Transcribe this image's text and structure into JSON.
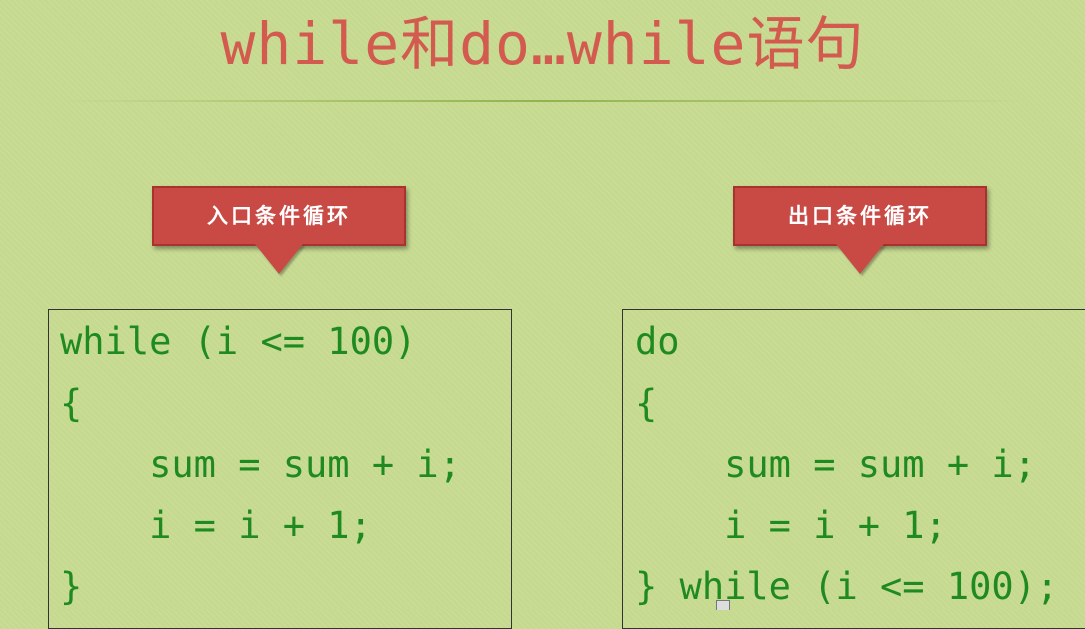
{
  "slide": {
    "title": "while和do…while语句"
  },
  "callouts": {
    "left_label": "入口条件循环",
    "right_label": "出口条件循环"
  },
  "code": {
    "while_loop": [
      "while (i <= 100)",
      "{",
      "    sum = sum + i;",
      "    i = i + 1;",
      "}"
    ],
    "do_while_loop": [
      "do",
      "{",
      "    sum = sum + i;",
      "    i = i + 1;",
      "} while (i <= 100);"
    ]
  },
  "colors": {
    "background": "#c5d98f",
    "title": "#d35a4e",
    "callout_fill": "#c94a45",
    "code_text": "#1f8a1f"
  }
}
